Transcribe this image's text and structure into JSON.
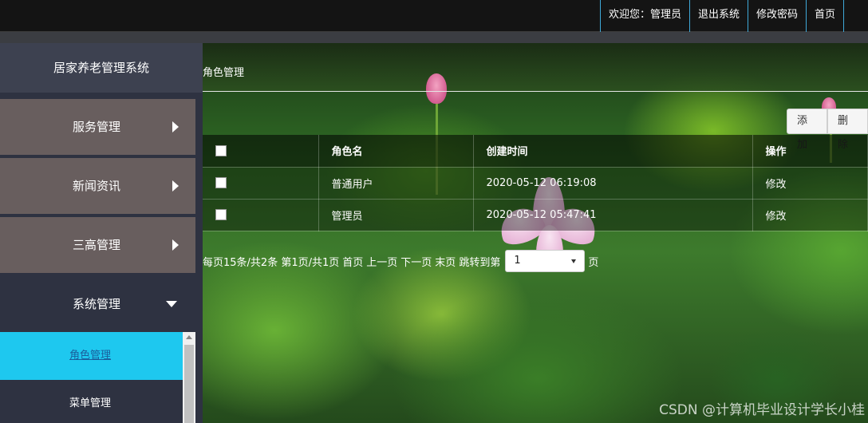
{
  "topnav": {
    "welcome": "欢迎您：管理员",
    "logout": "退出系统",
    "change_password": "修改密码",
    "home": "首页"
  },
  "sidebar": {
    "title": "居家养老管理系统",
    "items": [
      {
        "label": "服务管理"
      },
      {
        "label": "新闻资讯"
      },
      {
        "label": "三高管理"
      },
      {
        "label": "系统管理"
      }
    ],
    "submenu": [
      {
        "label": "角色管理"
      },
      {
        "label": "菜单管理"
      }
    ]
  },
  "main": {
    "heading": "角色管理",
    "add_label": "添加",
    "delete_label": "删除",
    "table": {
      "headers": [
        "角色名",
        "创建时间",
        "操作"
      ],
      "rows": [
        {
          "name": "普通用户",
          "created": "2020-05-12 06:19:08",
          "action": "修改"
        },
        {
          "name": "管理员",
          "created": "2020-05-12 05:47:41",
          "action": "修改"
        }
      ]
    },
    "pager": {
      "summary": "每页15条/共2条 第1页/共1页",
      "first": "首页",
      "prev": "上一页",
      "next": "下一页",
      "last": "末页",
      "jump_prefix": "跳转到第",
      "jump_value": "1",
      "jump_suffix": "页"
    }
  },
  "watermark": "CSDN @计算机毕业设计学长小桂",
  "colors": {
    "topbar": "#141414",
    "sidebar_item": "#685e5e",
    "sidebar_active": "#1ec8ef",
    "nav_divider": "#3fa9d9"
  }
}
